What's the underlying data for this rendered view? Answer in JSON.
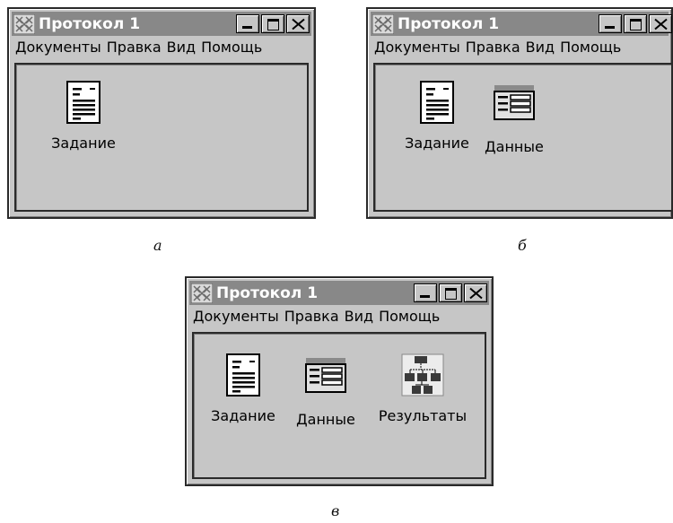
{
  "windows": [
    {
      "title": "Протокол 1",
      "menu": [
        "Документы",
        "Правка",
        "Вид",
        "Помощь"
      ],
      "documents": [
        {
          "label": "Задание",
          "icon": "text-document-icon"
        }
      ],
      "caption": "а"
    },
    {
      "title": "Протокол 1",
      "menu": [
        "Документы",
        "Правка",
        "Вид",
        "Помощь"
      ],
      "documents": [
        {
          "label": "Задание",
          "icon": "text-document-icon"
        },
        {
          "label": "Данные",
          "icon": "data-table-icon"
        }
      ],
      "caption": "б"
    },
    {
      "title": "Протокол 1",
      "menu": [
        "Документы",
        "Правка",
        "Вид",
        "Помощь"
      ],
      "documents": [
        {
          "label": "Задание",
          "icon": "text-document-icon"
        },
        {
          "label": "Данные",
          "icon": "data-table-icon"
        },
        {
          "label": "Результаты",
          "icon": "results-diagram-icon"
        }
      ],
      "caption": "в"
    }
  ],
  "colors": {
    "titlebar": "#888888",
    "window_face": "#c6c6c6",
    "border": "#2a2a2a"
  }
}
